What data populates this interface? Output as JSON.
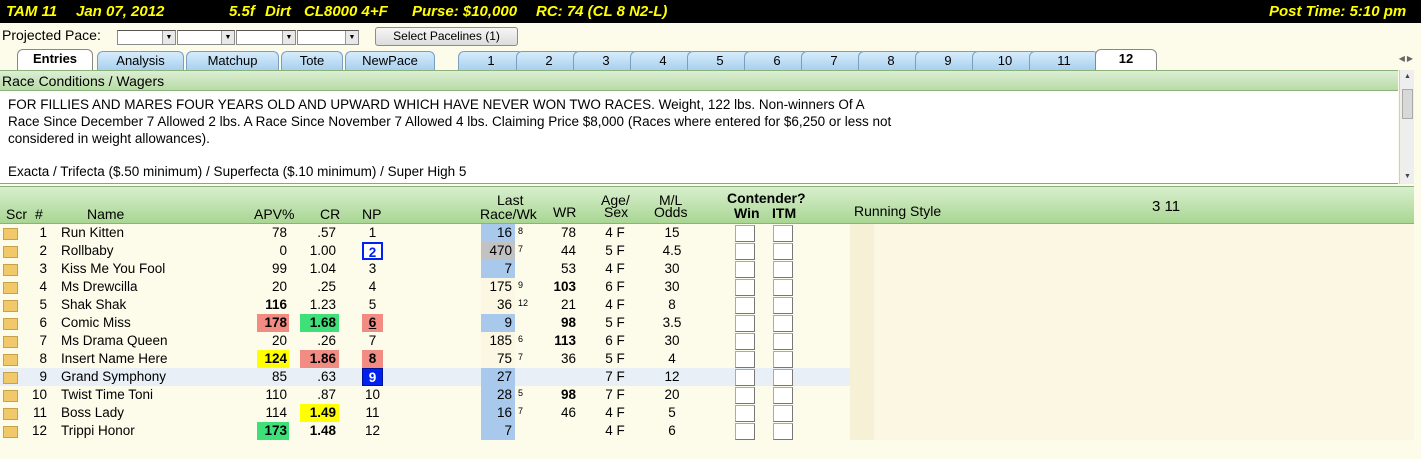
{
  "title": {
    "track_race": "TAM  11",
    "date": "Jan 07, 2012",
    "distance": "5.5f",
    "surface": "Dirt",
    "race_class": "CL8000  4+F",
    "purse": "Purse: $10,000",
    "rc": "RC: 74  (CL 8 N2-L)",
    "post_time": "Post Time: 5:10 pm"
  },
  "pace": {
    "label": "Projected Pace:",
    "select_button": "Select Pacelines  (1)"
  },
  "tabs": [
    "Entries",
    "Analysis",
    "Matchup",
    "Tote",
    "NewPace",
    "1",
    "2",
    "3",
    "4",
    "5",
    "6",
    "7",
    "8",
    "9",
    "10",
    "11",
    "12"
  ],
  "conditions": {
    "header": "Race Conditions / Wagers",
    "line1": "FOR FILLIES AND MARES FOUR YEARS OLD  AND UPWARD WHICH HAVE NEVER WON TWO RACES. Weight, 122 lbs. Non-winners Of A",
    "line2": "Race Since December 7 Allowed 2 lbs. A Race Since November 7 Allowed 4 lbs. Claiming Price $8,000 (Races where entered for $6,250 or less not",
    "line3": "considered in weight allowances).",
    "wagers": "Exacta / Trifecta ($.50 minimum) / Superfecta ($.10 minimum) / Super High 5"
  },
  "columns": {
    "scr": "Scr",
    "num": "#",
    "name": "Name",
    "apv": "APV%",
    "cr": "CR",
    "np": "NP",
    "last_top": "Last",
    "last_bottom": "Race/Wk",
    "wr": "WR",
    "age_top": "Age/",
    "age_bottom": "Sex",
    "ml_top": "M/L",
    "ml_bottom": "Odds",
    "contender": "Contender?",
    "win": "Win",
    "itm": "ITM",
    "running_style": "Running Style",
    "summary": "3  11"
  },
  "rows": [
    {
      "num": "1",
      "name": "Run Kitten",
      "apv": "78",
      "cr": ".57",
      "np": "1",
      "last": "16",
      "wk": "8",
      "wr": "78",
      "age": "4  F",
      "ml": "15"
    },
    {
      "num": "2",
      "name": "Rollbaby",
      "apv": "0",
      "cr": "1.00",
      "np": "2",
      "last": "470",
      "wk": "7",
      "wr": "44",
      "age": "5  F",
      "ml": "4.5"
    },
    {
      "num": "3",
      "name": "Kiss Me You Fool",
      "apv": "99",
      "cr": "1.04",
      "np": "3",
      "last": "7",
      "wk": "",
      "wr": "53",
      "age": "4  F",
      "ml": "30"
    },
    {
      "num": "4",
      "name": "Ms Drewcilla",
      "apv": "20",
      "cr": ".25",
      "np": "4",
      "last": "175",
      "wk": "9",
      "wr": "103",
      "age": "6  F",
      "ml": "30"
    },
    {
      "num": "5",
      "name": "Shak Shak",
      "apv": "116",
      "cr": "1.23",
      "np": "5",
      "last": "36",
      "wk": "12",
      "wr": "21",
      "age": "4  F",
      "ml": "8"
    },
    {
      "num": "6",
      "name": "Comic Miss",
      "apv": "178",
      "cr": "1.68",
      "np": "6",
      "last": "9",
      "wk": "",
      "wr": "98",
      "age": "5  F",
      "ml": "3.5"
    },
    {
      "num": "7",
      "name": "Ms Drama Queen",
      "apv": "20",
      "cr": ".26",
      "np": "7",
      "last": "185",
      "wk": "6",
      "wr": "113",
      "age": "6  F",
      "ml": "30"
    },
    {
      "num": "8",
      "name": "Insert Name Here",
      "apv": "124",
      "cr": "1.86",
      "np": "8",
      "last": "75",
      "wk": "7",
      "wr": "36",
      "age": "5  F",
      "ml": "4"
    },
    {
      "num": "9",
      "name": "Grand Symphony",
      "apv": "85",
      "cr": ".63",
      "np": "9",
      "last": "27",
      "wk": "",
      "wr": "",
      "age": "7  F",
      "ml": "12"
    },
    {
      "num": "10",
      "name": "Twist Time Toni",
      "apv": "110",
      "cr": ".87",
      "np": "10",
      "last": "28",
      "wk": "5",
      "wr": "98",
      "age": "7  F",
      "ml": "20"
    },
    {
      "num": "11",
      "name": "Boss Lady",
      "apv": "114",
      "cr": "1.49",
      "np": "11",
      "last": "16",
      "wk": "7",
      "wr": "46",
      "age": "4  F",
      "ml": "5"
    },
    {
      "num": "12",
      "name": "Trippi Honor",
      "apv": "173",
      "cr": "1.48",
      "np": "12",
      "last": "7",
      "wk": "",
      "wr": "",
      "age": "4  F",
      "ml": "6"
    }
  ],
  "colors": {
    "title_bg": "#000000",
    "title_fg": "#ffff00",
    "red": "#f28b82",
    "green": "#3fe07a",
    "yellow": "#ffff00",
    "blue": "#0022ee",
    "light_blue": "#a9c9ec",
    "grey": "#c2c2c2",
    "scr_box": "#f1c86a"
  }
}
